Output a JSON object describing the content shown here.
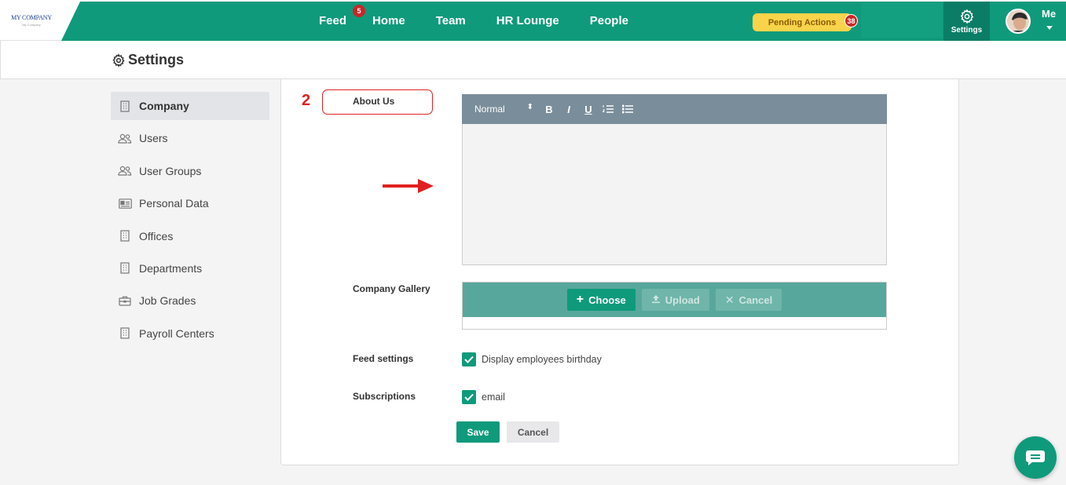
{
  "brand": {
    "logo_text": "MY COMPANY",
    "logo_sub": "My Company"
  },
  "nav": {
    "items": [
      {
        "label": "Feed",
        "badge": "5"
      },
      {
        "label": "Home"
      },
      {
        "label": "Team"
      },
      {
        "label": "HR Lounge"
      },
      {
        "label": "People"
      }
    ],
    "pending_actions": {
      "label": "Pending Actions",
      "count": "38"
    },
    "settings_label": "Settings",
    "user_label": "Me"
  },
  "page": {
    "title": "Settings"
  },
  "sidebar": {
    "items": [
      {
        "label": "Company",
        "icon": "building-icon",
        "active": true
      },
      {
        "label": "Users",
        "icon": "users-icon"
      },
      {
        "label": "User Groups",
        "icon": "users-icon"
      },
      {
        "label": "Personal Data",
        "icon": "id-card-icon"
      },
      {
        "label": "Offices",
        "icon": "building-icon"
      },
      {
        "label": "Departments",
        "icon": "building-icon"
      },
      {
        "label": "Job Grades",
        "icon": "briefcase-icon"
      },
      {
        "label": "Payroll Centers",
        "icon": "building-icon"
      }
    ]
  },
  "form": {
    "step_number": "2",
    "about_us_label": "About Us",
    "editor": {
      "text_size": "Normal",
      "tools": [
        "B",
        "I",
        "U"
      ]
    },
    "gallery_label": "Company Gallery",
    "gallery_buttons": {
      "choose": "Choose",
      "upload": "Upload",
      "cancel": "Cancel"
    },
    "feed_settings_label": "Feed settings",
    "feed_birthday_label": "Display employees birthday",
    "subscriptions_label": "Subscriptions",
    "subscription_email_label": "email",
    "save_label": "Save",
    "cancel_label": "Cancel"
  },
  "colors": {
    "brand_green": "#0f9a7b",
    "annotation_red": "#e02020",
    "pending_yellow": "#f9d44a"
  }
}
